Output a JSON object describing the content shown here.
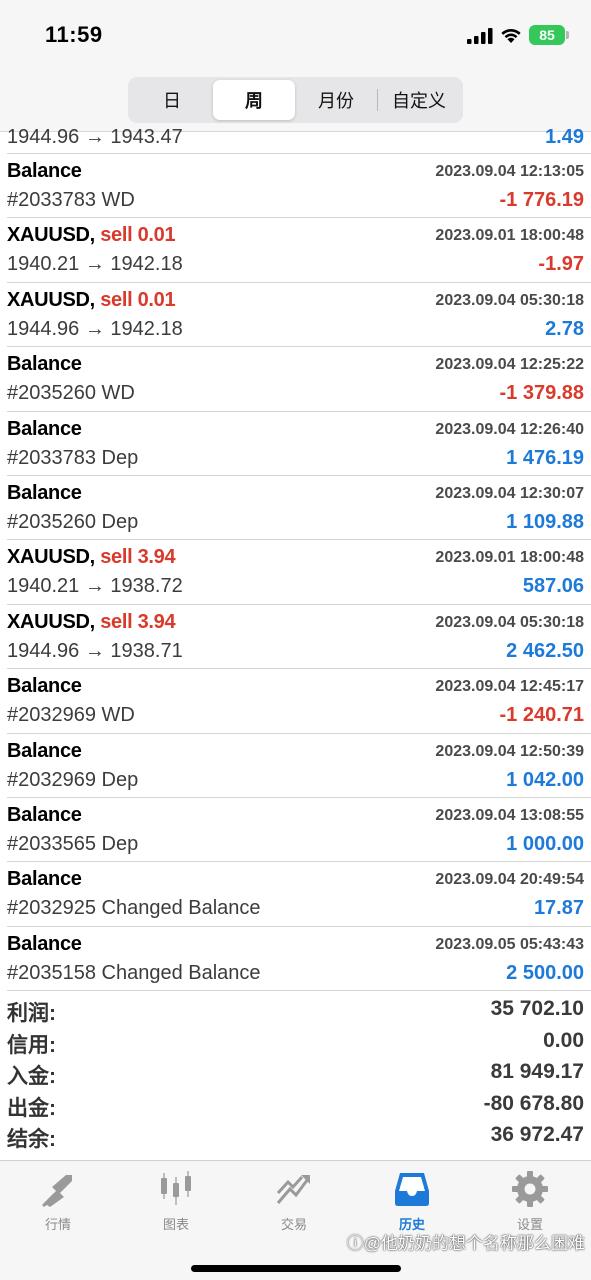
{
  "status_bar": {
    "time": "11:59",
    "battery": "85"
  },
  "period_tabs": [
    {
      "label": "日",
      "active": false
    },
    {
      "label": "周",
      "active": true
    },
    {
      "label": "月份",
      "active": false
    },
    {
      "label": "自定义",
      "active": false
    }
  ],
  "history": {
    "partial_row": {
      "prices": "1944.96 → 1943.47",
      "amount": "1.49"
    },
    "rows": [
      {
        "symbol": "Balance",
        "action": "",
        "sub": "#2033783 WD",
        "date": "2023.09.04 12:13:05",
        "amount": "-1 776.19",
        "sign": "neg"
      },
      {
        "symbol": "XAUUSD,",
        "action": "sell 0.01",
        "sub": "1940.21 → 1942.18",
        "date": "2023.09.01 18:00:48",
        "amount": "-1.97",
        "sign": "neg"
      },
      {
        "symbol": "XAUUSD,",
        "action": "sell 0.01",
        "sub": "1944.96 → 1942.18",
        "date": "2023.09.04 05:30:18",
        "amount": "2.78",
        "sign": "pos"
      },
      {
        "symbol": "Balance",
        "action": "",
        "sub": "#2035260 WD",
        "date": "2023.09.04 12:25:22",
        "amount": "-1 379.88",
        "sign": "neg"
      },
      {
        "symbol": "Balance",
        "action": "",
        "sub": "#2033783 Dep",
        "date": "2023.09.04 12:26:40",
        "amount": "1 476.19",
        "sign": "pos"
      },
      {
        "symbol": "Balance",
        "action": "",
        "sub": "#2035260 Dep",
        "date": "2023.09.04 12:30:07",
        "amount": "1 109.88",
        "sign": "pos"
      },
      {
        "symbol": "XAUUSD,",
        "action": "sell 3.94",
        "sub": "1940.21 → 1938.72",
        "date": "2023.09.01 18:00:48",
        "amount": "587.06",
        "sign": "pos"
      },
      {
        "symbol": "XAUUSD,",
        "action": "sell 3.94",
        "sub": "1944.96 → 1938.71",
        "date": "2023.09.04 05:30:18",
        "amount": "2 462.50",
        "sign": "pos"
      },
      {
        "symbol": "Balance",
        "action": "",
        "sub": "#2032969 WD",
        "date": "2023.09.04 12:45:17",
        "amount": "-1 240.71",
        "sign": "neg"
      },
      {
        "symbol": "Balance",
        "action": "",
        "sub": "#2032969 Dep",
        "date": "2023.09.04 12:50:39",
        "amount": "1 042.00",
        "sign": "pos"
      },
      {
        "symbol": "Balance",
        "action": "",
        "sub": "#2033565 Dep",
        "date": "2023.09.04 13:08:55",
        "amount": "1 000.00",
        "sign": "pos"
      },
      {
        "symbol": "Balance",
        "action": "",
        "sub": "#2032925 Changed Balance",
        "date": "2023.09.04 20:49:54",
        "amount": "17.87",
        "sign": "pos"
      },
      {
        "symbol": "Balance",
        "action": "",
        "sub": "#2035158 Changed Balance",
        "date": "2023.09.05 05:43:43",
        "amount": "2 500.00",
        "sign": "pos"
      }
    ]
  },
  "summary": [
    {
      "label": "利润:",
      "value": "35 702.10"
    },
    {
      "label": "信用:",
      "value": "0.00"
    },
    {
      "label": "入金:",
      "value": "81 949.17"
    },
    {
      "label": "出金:",
      "value": "-80 678.80"
    },
    {
      "label": "结余:",
      "value": "36 972.47"
    }
  ],
  "tab_bar": [
    {
      "label": "行情",
      "icon": "quotes-icon",
      "active": false
    },
    {
      "label": "图表",
      "icon": "chart-icon",
      "active": false
    },
    {
      "label": "交易",
      "icon": "trade-icon",
      "active": false
    },
    {
      "label": "历史",
      "icon": "history-icon",
      "active": true
    },
    {
      "label": "设置",
      "icon": "gear-icon",
      "active": false
    }
  ],
  "watermark": "ⓘ@他奶奶的想个名称那么困难",
  "colors": {
    "negative": "#d93a2b",
    "positive": "#1e7ad9",
    "active_tab": "#1e7ad9",
    "inactive_tab": "#8a8a8a",
    "battery": "#34c759"
  }
}
